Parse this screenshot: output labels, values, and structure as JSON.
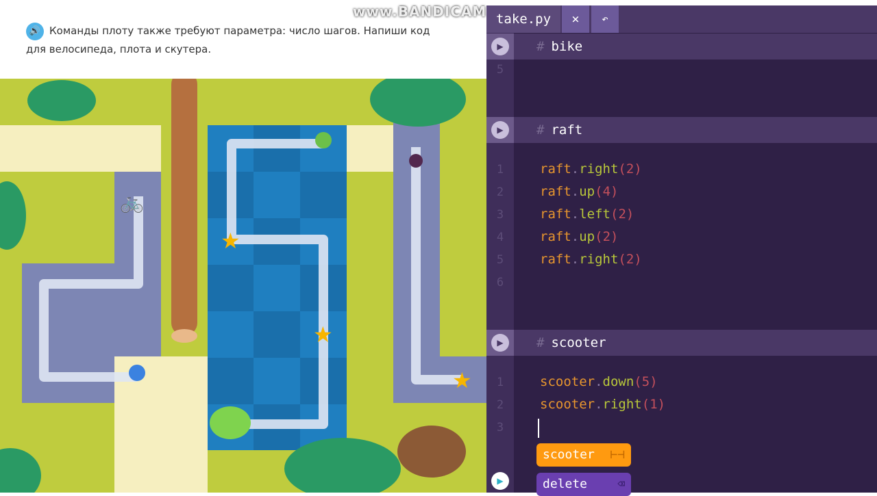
{
  "task": {
    "icon": "speaker-icon",
    "text": "Команды плоту также требуют параметра: число шагов. Напиши код для велосипеда, плота и скутера."
  },
  "watermark": "www.BANDICAM.com",
  "editor": {
    "tab_title": "take.py",
    "close_icon": "×",
    "undo_icon": "↶",
    "sections": [
      {
        "title": "bike",
        "lines": [
          {
            "n": "5",
            "obj": "",
            "method": "",
            "arg": ""
          }
        ]
      },
      {
        "title": "raft",
        "lines": [
          {
            "n": "1",
            "obj": "raft",
            "method": "right",
            "arg": "2"
          },
          {
            "n": "2",
            "obj": "raft",
            "method": "up",
            "arg": "4"
          },
          {
            "n": "3",
            "obj": "raft",
            "method": "left",
            "arg": "2"
          },
          {
            "n": "4",
            "obj": "raft",
            "method": "up",
            "arg": "2"
          },
          {
            "n": "5",
            "obj": "raft",
            "method": "right",
            "arg": "2"
          },
          {
            "n": "6",
            "obj": "",
            "method": "",
            "arg": ""
          }
        ]
      },
      {
        "title": "scooter",
        "lines": [
          {
            "n": "1",
            "obj": "scooter",
            "method": "down",
            "arg": "5"
          },
          {
            "n": "2",
            "obj": "scooter",
            "method": "right",
            "arg": "1"
          },
          {
            "n": "3",
            "obj": "",
            "method": "",
            "arg": ""
          }
        ]
      }
    ],
    "suggestions": [
      {
        "label": "scooter",
        "icon": "scooter-icon",
        "color": "#ff9a10"
      },
      {
        "label": "delete",
        "icon": "backspace-icon",
        "color": "#6a3fb0"
      }
    ]
  },
  "colors": {
    "editor_bg": "#2f2046",
    "water": "#1f7fc0",
    "grass": "#bfcc3e",
    "path": "#dfe6f3"
  }
}
